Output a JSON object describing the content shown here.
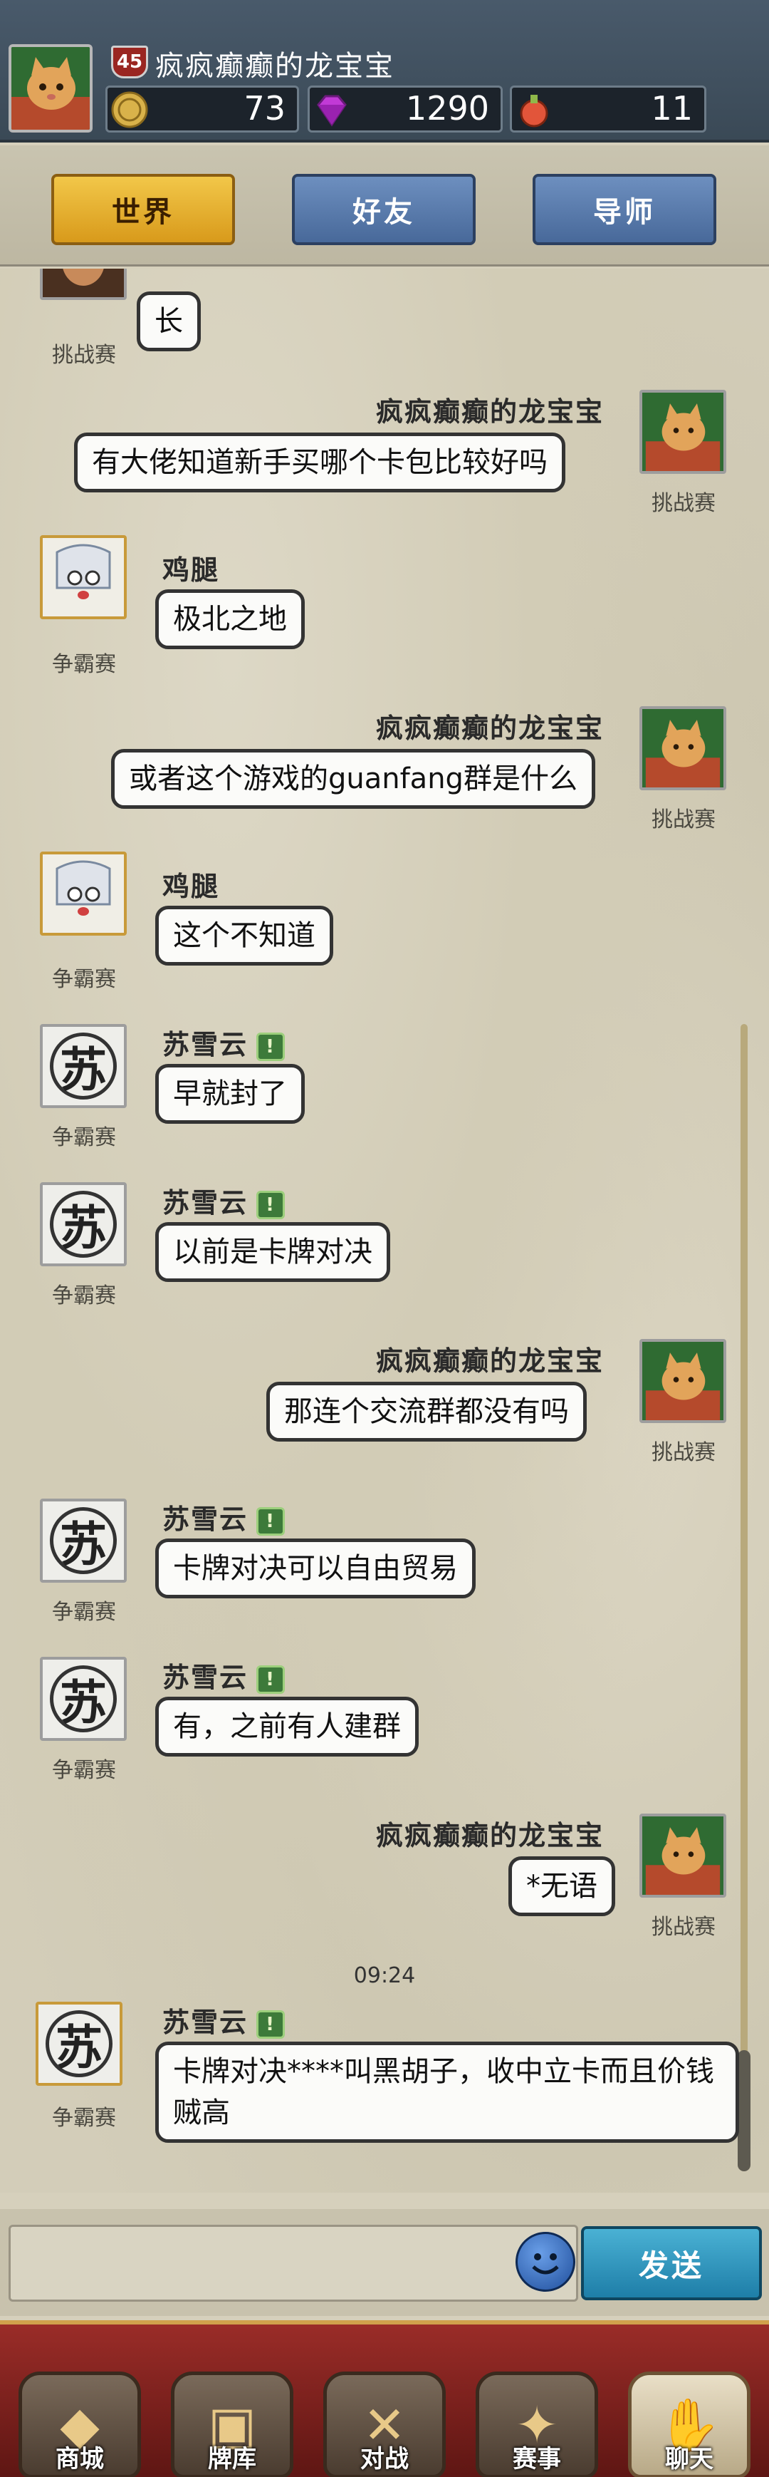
{
  "header": {
    "player_name": "疯疯癫癫的龙宝宝",
    "level": "45",
    "gold": "73",
    "gems": "1290",
    "energy": "11"
  },
  "tabs": [
    {
      "label": "世界",
      "active": true
    },
    {
      "label": "好友",
      "active": false
    },
    {
      "label": "导师",
      "active": false
    }
  ],
  "chat": {
    "messages": [
      {
        "sender": "",
        "tag": "挑战赛",
        "text": "长",
        "side": "left"
      },
      {
        "sender": "疯疯癫癫的龙宝宝",
        "tag": "挑战赛",
        "text": "有大佬知道新手买哪个卡包比较好吗",
        "side": "right"
      },
      {
        "sender": "鸡腿",
        "tag": "争霸赛",
        "text": "极北之地",
        "side": "left"
      },
      {
        "sender": "疯疯癫癫的龙宝宝",
        "tag": "挑战赛",
        "text": "或者这个游戏的guanfang群是什么",
        "side": "right"
      },
      {
        "sender": "鸡腿",
        "tag": "争霸赛",
        "text": "这个不知道",
        "side": "left"
      },
      {
        "sender": "苏雪云",
        "tag": "争霸赛",
        "text": "早就封了",
        "side": "left"
      },
      {
        "sender": "苏雪云",
        "tag": "争霸赛",
        "text": "以前是卡牌对决",
        "side": "left"
      },
      {
        "sender": "疯疯癫癫的龙宝宝",
        "tag": "挑战赛",
        "text": "那连个交流群都没有吗",
        "side": "right"
      },
      {
        "sender": "苏雪云",
        "tag": "争霸赛",
        "text": "卡牌对决可以自由贸易",
        "side": "left"
      },
      {
        "sender": "苏雪云",
        "tag": "争霸赛",
        "text": "有，之前有人建群",
        "side": "left"
      },
      {
        "sender": "疯疯癫癫的龙宝宝",
        "tag": "挑战赛",
        "text": "*无语",
        "side": "right"
      },
      {
        "sender": "苏雪云",
        "tag": "争霸赛",
        "text": "卡牌对决****叫黑胡子，收中立卡而且价钱贼高",
        "side": "left"
      }
    ],
    "timestamp": "09:24",
    "vip_mark": "!",
    "avatar_glyph": "苏"
  },
  "input": {
    "placeholder": "",
    "send_label": "发送"
  },
  "nav": [
    {
      "label": "商城",
      "icon": "shop-icon",
      "active": false
    },
    {
      "label": "牌库",
      "icon": "card-deck-icon",
      "active": false
    },
    {
      "label": "对战",
      "icon": "crossed-swords-icon",
      "active": false
    },
    {
      "label": "赛事",
      "icon": "tournament-icon",
      "active": false
    },
    {
      "label": "聊天",
      "icon": "chat-handshake-icon",
      "active": true
    }
  ],
  "colors": {
    "accent_gold": "#e4b23a",
    "tab_blue": "#5a7cad",
    "nav_red": "#9a2c28",
    "send_blue": "#2c93bd"
  }
}
